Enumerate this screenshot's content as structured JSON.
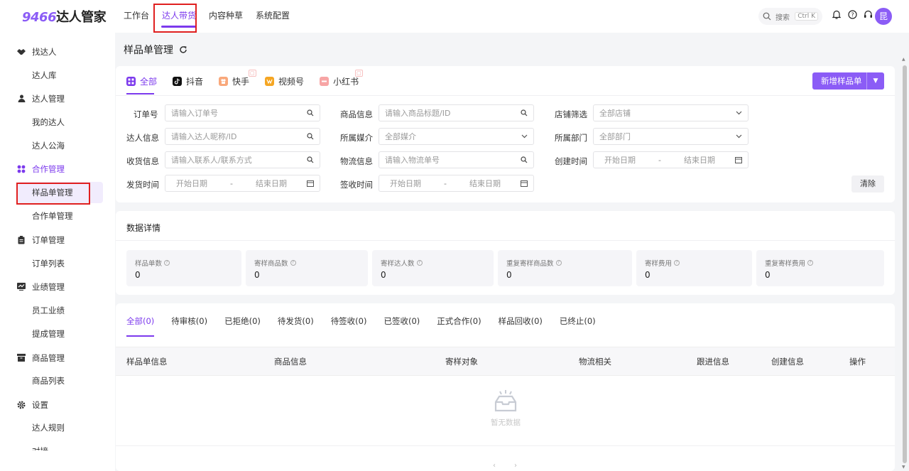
{
  "brand": {
    "number": "9466",
    "name": "达人管家"
  },
  "top_nav": [
    "工作台",
    "达人带货",
    "内容种草",
    "系统配置"
  ],
  "search": {
    "placeholder": "搜索",
    "shortcut": "Ctrl K"
  },
  "avatar": "昆",
  "sidebar": {
    "groups": [
      {
        "label": "找达人",
        "icon": "handshake-icon",
        "items": [
          "达人库"
        ]
      },
      {
        "label": "达人管理",
        "icon": "person-icon",
        "items": [
          "我的达人",
          "达人公海"
        ]
      },
      {
        "label": "合作管理",
        "icon": "apps-icon",
        "items": [
          "样品单管理",
          "合作单管理"
        ]
      },
      {
        "label": "订单管理",
        "icon": "clipboard-icon",
        "items": [
          "订单列表"
        ]
      },
      {
        "label": "业绩管理",
        "icon": "chart-icon",
        "items": [
          "员工业绩",
          "提成管理"
        ]
      },
      {
        "label": "商品管理",
        "icon": "box-icon",
        "items": [
          "商品列表"
        ]
      },
      {
        "label": "设置",
        "icon": "gear-icon",
        "items": [
          "达人规则",
          "对接"
        ]
      }
    ]
  },
  "page_title": "样品单管理",
  "platform_tabs": [
    "全部",
    "抖音",
    "快手",
    "视频号",
    "小红书"
  ],
  "new_button": "新增样品单",
  "filters": {
    "order_no": {
      "label": "订单号",
      "placeholder": "请输入订单号"
    },
    "product": {
      "label": "商品信息",
      "placeholder": "请输入商品标题/ID"
    },
    "shop": {
      "label": "店铺筛选",
      "value": "全部店铺"
    },
    "talent": {
      "label": "达人信息",
      "placeholder": "请输入达人昵称/ID"
    },
    "media": {
      "label": "所属媒介",
      "value": "全部媒介"
    },
    "dept": {
      "label": "所属部门",
      "value": "全部部门"
    },
    "receiver": {
      "label": "收货信息",
      "placeholder": "请输入联系人/联系方式"
    },
    "logistics": {
      "label": "物流信息",
      "placeholder": "请输入物流单号"
    },
    "created": {
      "label": "创建时间",
      "start": "开始日期",
      "end": "结束日期"
    },
    "shipped": {
      "label": "发货时间",
      "start": "开始日期",
      "end": "结束日期"
    },
    "signed": {
      "label": "签收时间",
      "start": "开始日期",
      "end": "结束日期"
    },
    "clear": "清除"
  },
  "stats_title": "数据详情",
  "stats": [
    {
      "label": "样品单数",
      "value": "0"
    },
    {
      "label": "寄样商品数",
      "value": "0"
    },
    {
      "label": "寄样达人数",
      "value": "0"
    },
    {
      "label": "重复寄样商品数",
      "value": "0"
    },
    {
      "label": "寄样费用",
      "value": "0"
    },
    {
      "label": "重复寄样费用",
      "value": "0"
    }
  ],
  "status_tabs": [
    "全部(0)",
    "待审核(0)",
    "已拒绝(0)",
    "待发货(0)",
    "待签收(0)",
    "已签收(0)",
    "正式合作(0)",
    "样品回收(0)",
    "已终止(0)"
  ],
  "table_headers": [
    "样品单信息",
    "商品信息",
    "寄样对象",
    "物流相关",
    "跟进信息",
    "创建信息",
    "操作"
  ],
  "empty_text": "暂无数据",
  "colors": {
    "accent": "#8b5cf6",
    "highlight_box": "#e02020"
  }
}
